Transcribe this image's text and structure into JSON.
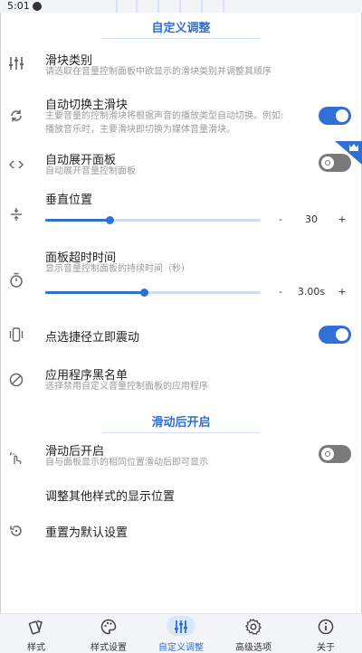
{
  "statusbar": {
    "time": "5:01"
  },
  "sections": {
    "custom": "自定义调整",
    "swipe": "滑动后开启"
  },
  "rows": {
    "slider_type": {
      "title": "滑块类别",
      "subtitle": "请选取在音量控制面板中欲显示的滑块类别并调整其顺序"
    },
    "auto_switch": {
      "title": "自动切换主滑块",
      "subtitle_line1": "主要音量的控制滑块将根据声音的播放类型自动切换。例如:",
      "subtitle_line2": "播放音乐时，主要滑块即切换为媒体音量滑块。",
      "enabled": true
    },
    "auto_expand": {
      "title": "自动展开面板",
      "subtitle": "自动展开音量控制面板",
      "enabled": false
    },
    "vertical_pos": {
      "title": "垂直位置",
      "value": "30",
      "minus": "-",
      "plus": "+",
      "fraction": 0.3
    },
    "timeout": {
      "title": "面板超时时间",
      "subtitle": "显示音量控制面板的持续时间（秒）",
      "value": "3.00s",
      "minus": "-",
      "plus": "+",
      "fraction": 0.46
    },
    "vibrate": {
      "title": "点选捷径立即震动",
      "enabled": true
    },
    "blacklist": {
      "title": "应用程序黑名单",
      "subtitle": "选择禁用自定义音量控制面板的应用程序"
    },
    "swipe_open": {
      "title": "滑动后开启",
      "subtitle": "自与面板显示的相同位置滑动后即可显示",
      "enabled": false
    },
    "other_styles": {
      "title": "调整其他样式的显示位置"
    },
    "reset": {
      "title": "重置为默认设置"
    }
  },
  "nav": [
    {
      "label": "样式",
      "icon": "style-icon",
      "active": false
    },
    {
      "label": "样式设置",
      "icon": "palette-icon",
      "active": false
    },
    {
      "label": "自定义调整",
      "icon": "tune-icon",
      "active": true
    },
    {
      "label": "高级选项",
      "icon": "gear-icon",
      "active": false
    },
    {
      "label": "关于",
      "icon": "info-icon",
      "active": false
    }
  ],
  "colors": {
    "accent": "#2f6fd6",
    "toggle_off": "#7a7a7a",
    "nav_bg": "#f3f4f8"
  }
}
